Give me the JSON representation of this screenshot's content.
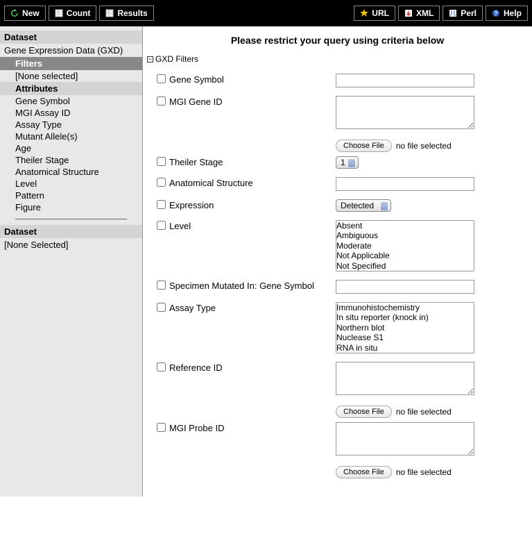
{
  "toolbar": {
    "left": {
      "new": "New",
      "count": "Count",
      "results": "Results"
    },
    "right": {
      "url": "URL",
      "xml": "XML",
      "perl": "Perl",
      "help": "Help"
    }
  },
  "sidebar": {
    "dataset_header": "Dataset",
    "dataset_name": "Gene Expression Data (GXD)",
    "filters_header": "Filters",
    "filters_none": "[None selected]",
    "attributes_header": "Attributes",
    "attributes": [
      "Gene Symbol",
      "MGI Assay ID",
      "Assay Type",
      "Mutant Allele(s)",
      "Age",
      "Theiler Stage",
      "Anatomical Structure",
      "Level",
      "Pattern",
      "Figure"
    ],
    "dataset2_header": "Dataset",
    "dataset2_none": "[None Selected]"
  },
  "main": {
    "title": "Please restrict your query using criteria below",
    "section_label": "GXD Filters",
    "file_button": "Choose File",
    "file_status": "no file selected",
    "filters": {
      "gene_symbol": "Gene Symbol",
      "mgi_gene_id": "MGI Gene ID",
      "theiler_stage": "Theiler Stage",
      "theiler_value": "1",
      "anatomical": "Anatomical Structure",
      "expression": "Expression",
      "expression_value": "Detected",
      "level": "Level",
      "level_options": [
        "Absent",
        "Ambiguous",
        "Moderate",
        "Not Applicable",
        "Not Specified"
      ],
      "specimen": "Specimen Mutated In: Gene Symbol",
      "assay_type": "Assay Type",
      "assay_options": [
        "Immunohistochemistry",
        "In situ reporter (knock in)",
        "Northern blot",
        "Nuclease S1",
        "RNA in situ"
      ],
      "reference_id": "Reference ID",
      "mgi_probe_id": "MGI Probe ID"
    }
  }
}
